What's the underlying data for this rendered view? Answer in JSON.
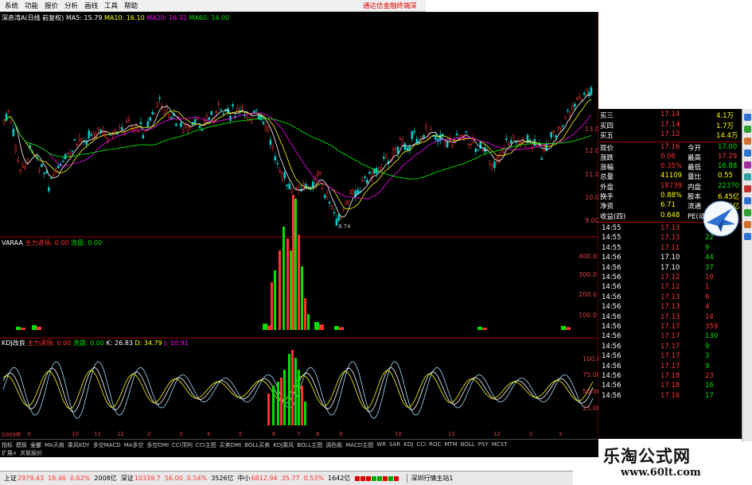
{
  "menu": {
    "items": [
      "系统",
      "功能",
      "报价",
      "分析",
      "画线",
      "工具",
      "帮助"
    ],
    "promo": "通达信金融终端",
    "promo2": "深"
  },
  "main_chart": {
    "title": "深赤湾A(日线 前复权)",
    "ma5": "MA5: 15.79",
    "ma10": "MA10: 16.10",
    "ma20": "MA20: 16.32",
    "ma60": "MA60: 14.00",
    "y_ticks": [
      "13.00",
      "12.00",
      "11.00",
      "10.00",
      "9.00"
    ],
    "low_label": "8.74"
  },
  "vol_panel": {
    "title": "VARAA",
    "main_force": "主力进场: 0.00",
    "wash": "洗盘: 0.00",
    "y_ticks": [
      "400.0",
      "300.0",
      "200.0",
      "100.0"
    ]
  },
  "kdj_panel": {
    "title": "KDJ改良",
    "main_force": "主力进场: 0.00",
    "wash": "洗盘: 0.00",
    "k": "K: 26.83",
    "d": "D: 34.79",
    "j": "J: 10.91",
    "y_ticks": [
      "100.0",
      "75.00",
      "50.00",
      "25.00"
    ]
  },
  "x_axis": {
    "year": "2009年",
    "labels": [
      "9",
      "10",
      "11",
      "12",
      "2",
      "3",
      "4",
      "5",
      "6",
      "7",
      "8",
      "9",
      "10",
      "11",
      "12",
      "2",
      "3"
    ]
  },
  "quote": {
    "bids": [
      {
        "label": "买三",
        "price": "17.14",
        "vol": "4.1万"
      },
      {
        "label": "买四",
        "price": "17.14",
        "vol": "1.7万"
      },
      {
        "label": "买五",
        "price": "17.12",
        "vol": "14.4万"
      }
    ],
    "stats": [
      {
        "k1": "现价",
        "v1": "17.16",
        "k2": "今开",
        "v2": "17.00"
      },
      {
        "k1": "涨跌",
        "v1": "0.06",
        "k2": "最高",
        "v2": "17.29"
      },
      {
        "k1": "涨幅",
        "v1": "0.35%",
        "k2": "最低",
        "v2": "16.88"
      },
      {
        "k1": "总量",
        "v1": "41109",
        "k2": "量比",
        "v2": "0.55"
      },
      {
        "k1": "外盘",
        "v1": "18739",
        "k2": "内盘",
        "v2": "22370"
      },
      {
        "k1": "换手",
        "v1": "0.88%",
        "k2": "股本",
        "v2": "6.45亿"
      },
      {
        "k1": "净资",
        "v1": "6.71",
        "k2": "流通",
        "v2": "4.65亿"
      },
      {
        "k1": "收益(四)",
        "v1": "0.648",
        "k2": "PE(动)",
        "v2": "19.5"
      }
    ],
    "ticks": [
      {
        "t": "14:55",
        "p": "17.13",
        "v": "107",
        "c": "red"
      },
      {
        "t": "14:55",
        "p": "17.13",
        "v": "22",
        "c": "grn"
      },
      {
        "t": "14:55",
        "p": "17.11",
        "v": "9",
        "c": "grn"
      },
      {
        "t": "14:56",
        "p": "17.10",
        "v": "44",
        "c": "grn"
      },
      {
        "t": "14:56",
        "p": "17.10",
        "v": "37",
        "c": "grn"
      },
      {
        "t": "14:56",
        "p": "17.12",
        "v": "10",
        "c": "red"
      },
      {
        "t": "14:56",
        "p": "17.12",
        "v": "1",
        "c": "red"
      },
      {
        "t": "14:56",
        "p": "17.13",
        "v": "6",
        "c": "red"
      },
      {
        "t": "14:56",
        "p": "17.13",
        "v": "4",
        "c": "red"
      },
      {
        "t": "14:56",
        "p": "17.13",
        "v": "14",
        "c": "red"
      },
      {
        "t": "14:56",
        "p": "17.17",
        "v": "359",
        "c": "red"
      },
      {
        "t": "14:56",
        "p": "17.17",
        "v": "130",
        "c": "grn"
      },
      {
        "t": "14:56",
        "p": "17.17",
        "v": "9",
        "c": "grn"
      },
      {
        "t": "14:56",
        "p": "17.17",
        "v": "3",
        "c": "grn"
      },
      {
        "t": "14:56",
        "p": "17.17",
        "v": "9",
        "c": "grn"
      },
      {
        "t": "14:56",
        "p": "17.18",
        "v": "23",
        "c": "red"
      },
      {
        "t": "14:56",
        "p": "17.18",
        "v": "16",
        "c": "grn"
      },
      {
        "t": "14:56",
        "p": "17.16",
        "v": "17",
        "c": "grn"
      }
    ]
  },
  "tabs": {
    "row1": [
      "指标",
      "模板",
      "全部",
      "MA天肩",
      "乘风KDY",
      "多空MACD",
      "MA多空",
      "多空DMI",
      "CCI顶列",
      "CCI主图",
      "买卖DMI",
      "BOLL买卖",
      "KDJ乘风",
      "BOLL主图",
      "调色板",
      "MACD主图",
      "WR",
      "SAR",
      "KDJ",
      "CCI",
      "ROC",
      "MTM",
      "BOLL",
      "PSY",
      "MCST"
    ],
    "active": "全部",
    "row2": [
      "扩展∧",
      "关联报价"
    ]
  },
  "status": {
    "sh_label": "上证",
    "sh": "2979.43",
    "sh_chg": "18.46",
    "sh_pct": "0.62%",
    "sh_amt": "2008亿",
    "sz_label": "深证",
    "sz": "10339.7",
    "sz_chg": "56.00",
    "sz_pct": "0.54%",
    "sz_amt": "3526亿",
    "zx_label": "中小",
    "zx": "6812.94",
    "zx_chg": "35.77",
    "zx_pct": "0.53%",
    "zx_amt": "1642亿",
    "market": "深圳行情主站1"
  },
  "watermark": {
    "title": "乐淘公式网",
    "url": "www.60lt.com"
  },
  "colors": {
    "up": "#ff3232",
    "down": "#00e000",
    "ma5": "#ffffff",
    "ma10": "#ffff00",
    "ma20": "#ff00ff",
    "ma60": "#00ff00"
  }
}
